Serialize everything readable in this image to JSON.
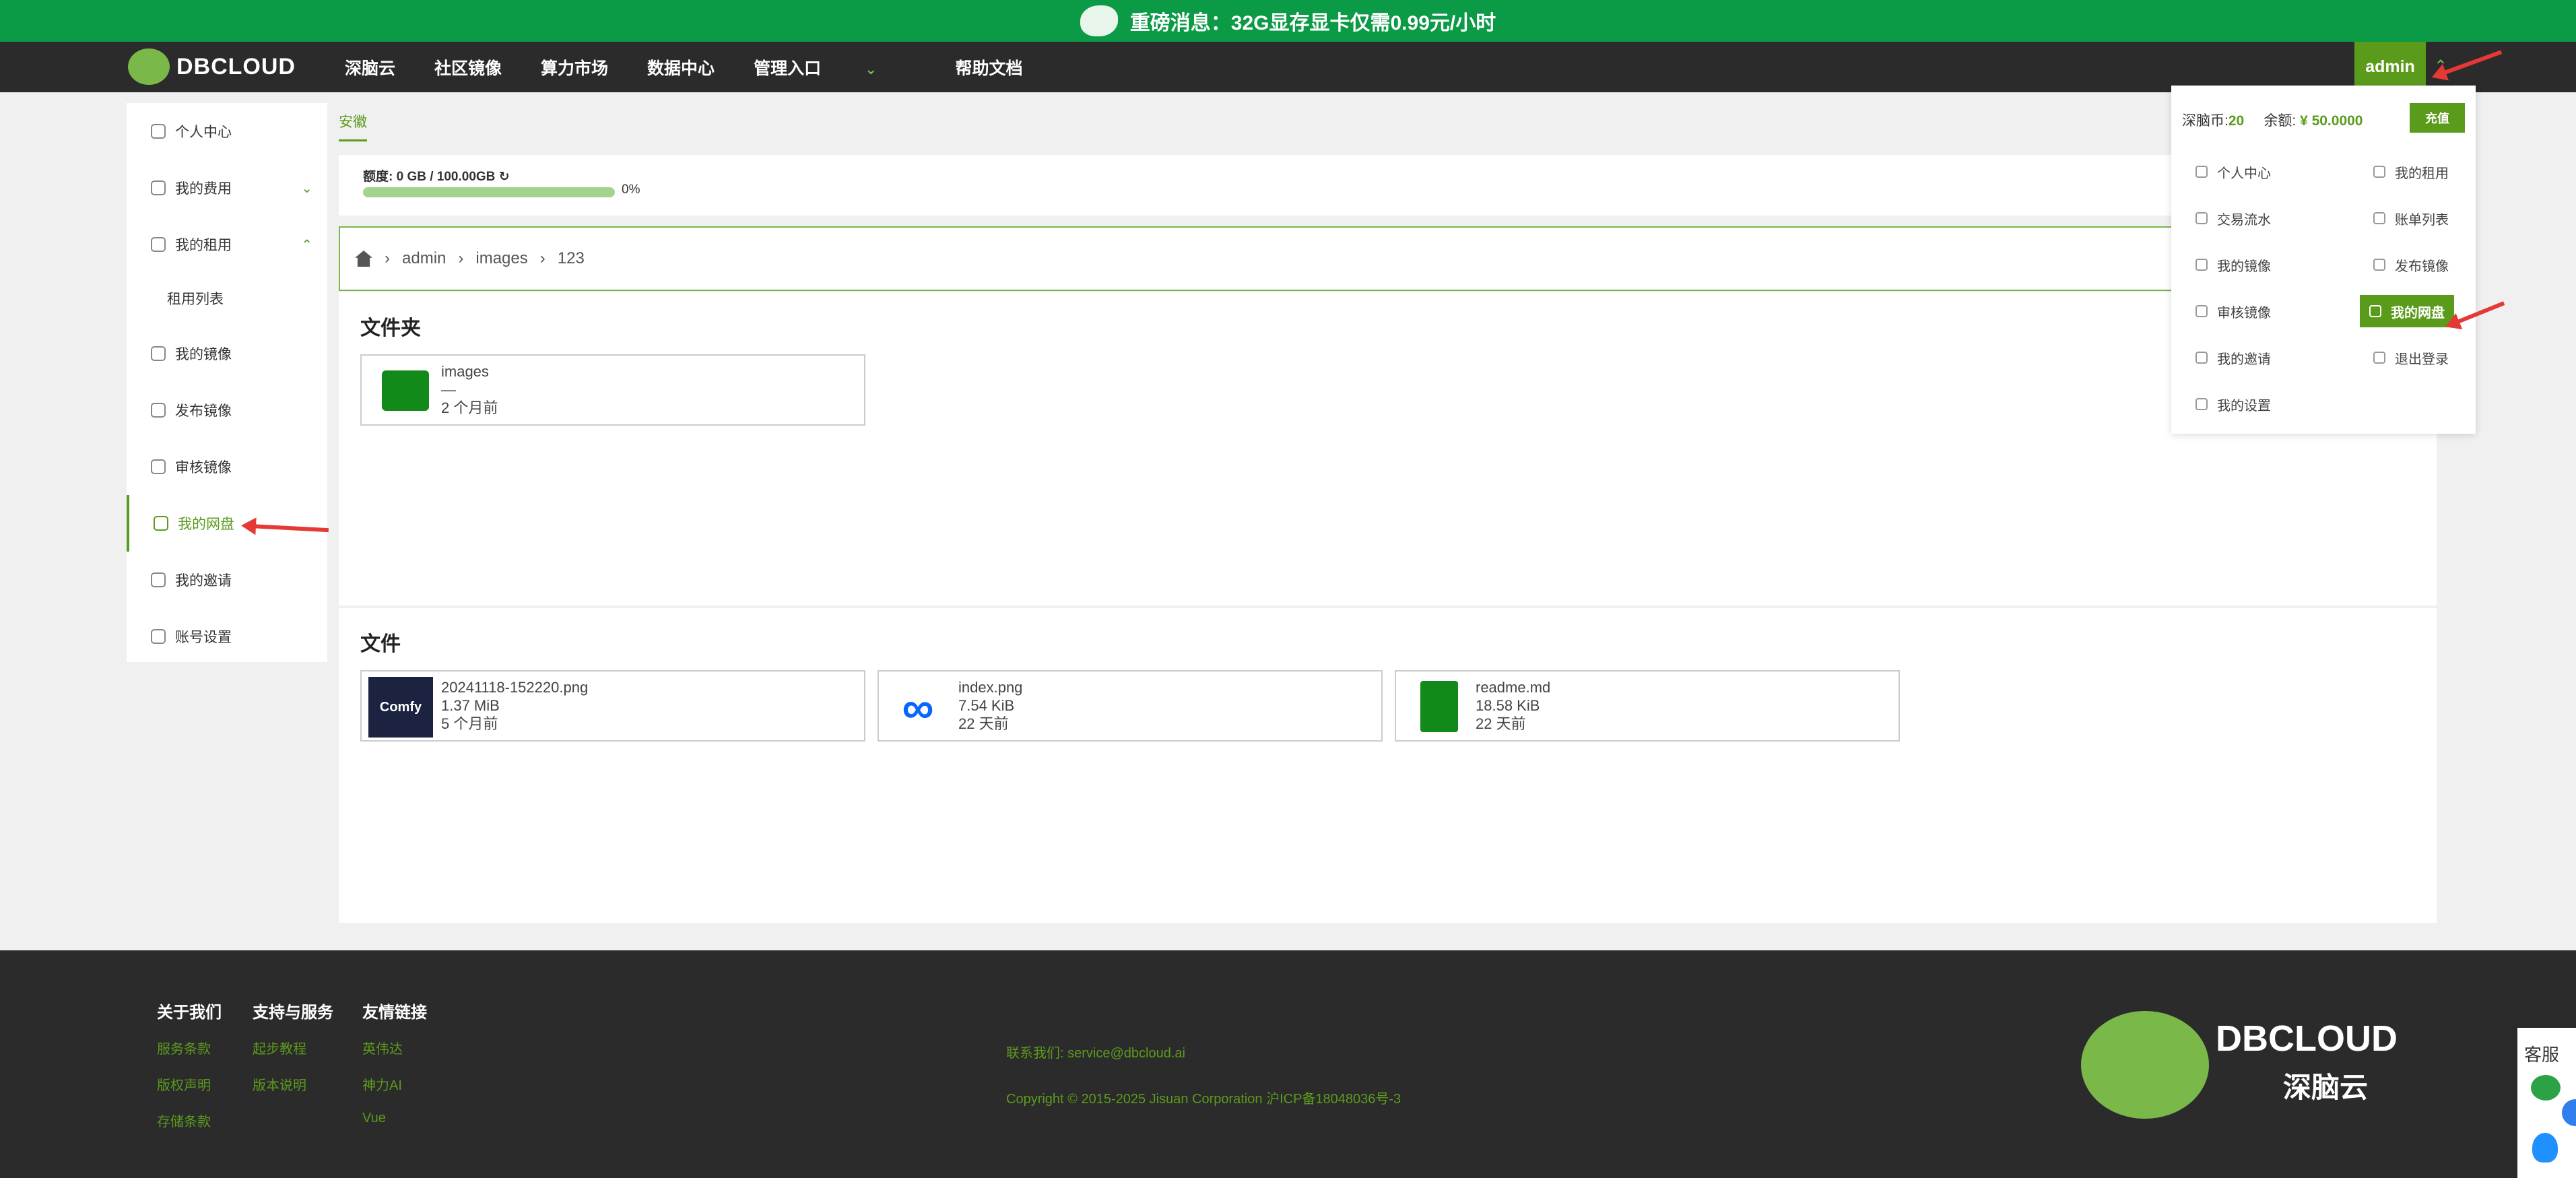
{
  "banner": {
    "text": "重磅消息：32G显存显卡仅需0.99元/小时"
  },
  "brand": {
    "name": "DBCLOUD",
    "chinese": "深脑云"
  },
  "nav": {
    "items": [
      "深脑云",
      "社区镜像",
      "算力市场",
      "数据中心",
      "管理入口",
      "帮助文档"
    ],
    "user": "admin"
  },
  "sidebar": {
    "items": [
      {
        "label": "个人中心",
        "icon": "dashboard-icon"
      },
      {
        "label": "我的费用",
        "icon": "database-icon"
      },
      {
        "label": "我的租用",
        "icon": "search-icon"
      },
      {
        "label": "租用列表",
        "icon": ""
      },
      {
        "label": "我的镜像",
        "icon": "box-icon"
      },
      {
        "label": "发布镜像",
        "icon": "lock-icon"
      },
      {
        "label": "审核镜像",
        "icon": "eye-icon"
      },
      {
        "label": "我的网盘",
        "icon": "bag-icon"
      },
      {
        "label": "我的邀请",
        "icon": "send-icon"
      },
      {
        "label": "账号设置",
        "icon": "gear-icon"
      }
    ]
  },
  "tab": "安徽",
  "quota": {
    "label": "额度: 0 GB / 100.00GB",
    "percent": "0%",
    "progress": 0
  },
  "breadcrumb": [
    "admin",
    "images",
    "123"
  ],
  "folders": {
    "title": "文件夹",
    "items": [
      {
        "name": "images",
        "size": "—",
        "time": "2 个月前"
      }
    ]
  },
  "files": {
    "title": "文件",
    "items": [
      {
        "name": "20241118-152220.png",
        "size": "1.37 MiB",
        "time": "5 个月前",
        "thumb": "Comfy"
      },
      {
        "name": "index.png",
        "size": "7.54 KiB",
        "time": "22 天前"
      },
      {
        "name": "readme.md",
        "size": "18.58 KiB",
        "time": "22 天前"
      }
    ]
  },
  "dropdown": {
    "coins_label": "深脑币:",
    "coins_value": "20",
    "balance_label": "余额: ",
    "balance_value": "¥ 50.0000",
    "recharge": "充值",
    "items": [
      "个人中心",
      "我的租用",
      "交易流水",
      "账单列表",
      "我的镜像",
      "发布镜像",
      "审核镜像",
      "我的网盘",
      "我的邀请",
      "退出登录",
      "我的设置"
    ]
  },
  "footer": {
    "col1": {
      "title": "关于我们",
      "links": [
        "服务条款",
        "版权声明",
        "存储条款"
      ]
    },
    "col2": {
      "title": "支持与服务",
      "links": [
        "起步教程",
        "版本说明"
      ]
    },
    "col3": {
      "title": "友情链接",
      "links": [
        "英伟达",
        "神力AI",
        "Vue"
      ]
    },
    "contact": "联系我们: service@dbcloud.ai",
    "copyright": "Copyright © 2015-2025 Jisuan Corporation 沪ICP备18048036号-3"
  },
  "float_service": {
    "label": "客服"
  }
}
